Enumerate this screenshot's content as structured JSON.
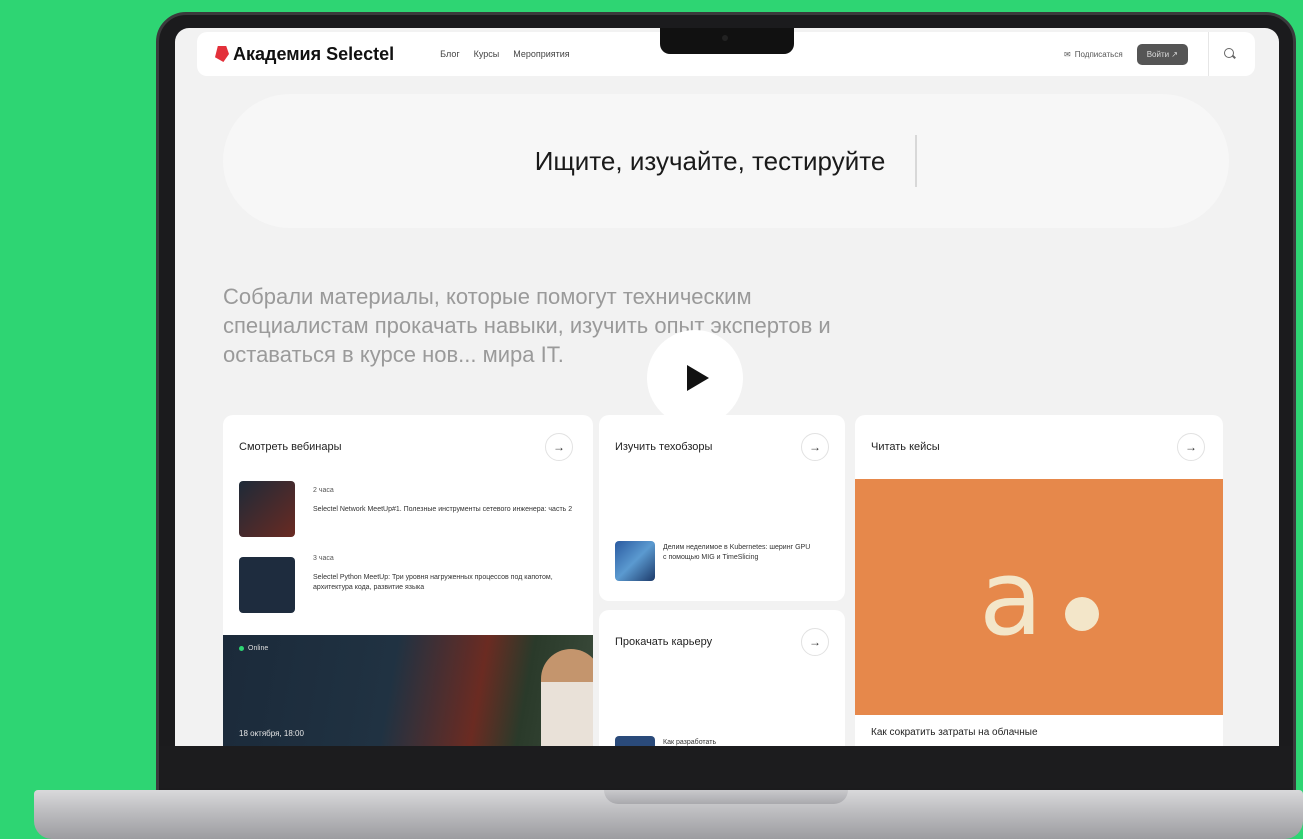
{
  "header": {
    "logo": "Академия Selectel",
    "nav": [
      "Блог",
      "Курсы",
      "Мероприятия"
    ],
    "subscribe_label": "Подписаться",
    "login_label": "Войти ↗"
  },
  "hero": {
    "search_text": "Ищите, изучайте, тестируйте"
  },
  "intro": {
    "text": "Собрали материалы, которые помогут техническим специалистам прокачать навыки, изучить опыт экспертов и оставаться в курсе нов... мира IT."
  },
  "cards": {
    "webinars": {
      "title": "Смотреть вебинары",
      "items": [
        {
          "meta": "2 часа",
          "title": "Selectel Network MeetUp#1. Полезные инструменты сетевого инженера: часть 2"
        },
        {
          "meta": "3 часа",
          "title": "Selectel Python MeetUp: Три уровня нагруженных процессов под капотом, архитектура кода, развитие языка"
        }
      ],
      "banner": {
        "status": "Online",
        "date": "18 октября, 18:00"
      }
    },
    "reviews": {
      "title": "Изучить техобзоры",
      "item_title": "Делим неделимое в Kubernetes: шеринг GPU с помощью MIG и TimeSlicing"
    },
    "career": {
      "title": "Прокачать карьеру",
      "item_title": "Как разработать"
    },
    "cases": {
      "title": "Читать кейсы",
      "logo_letter": "a",
      "item_title": "Как сократить затраты на облачные"
    }
  },
  "colors": {
    "background": "#2ed573",
    "accent_orange": "#e6884b",
    "brand_red": "#e3303a"
  }
}
